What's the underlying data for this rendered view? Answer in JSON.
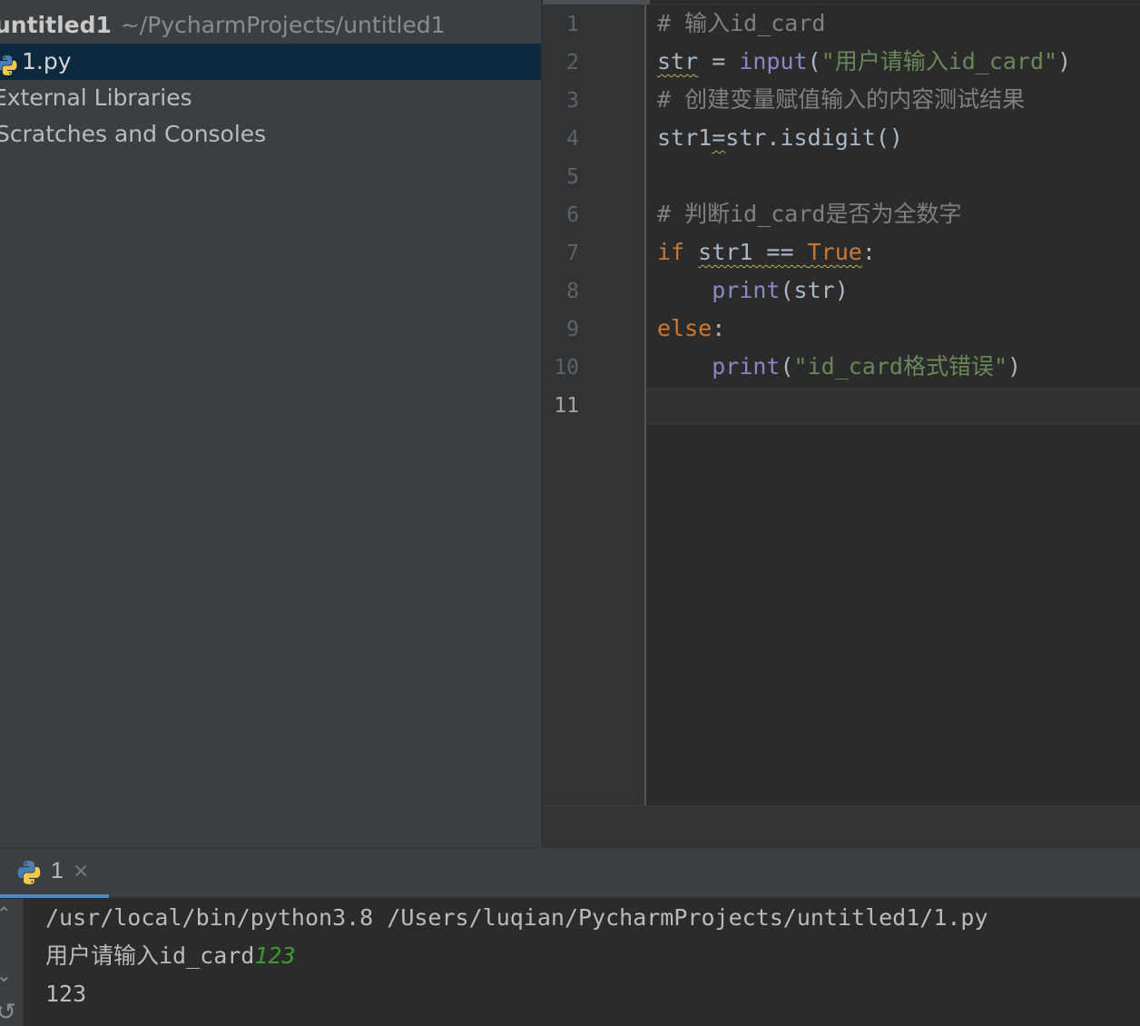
{
  "project_tree": {
    "root_name": "untitled1",
    "root_path": "~/PycharmProjects/untitled1",
    "file_name": "1.py",
    "external_libraries": "External Libraries",
    "scratches": "Scratches and Consoles"
  },
  "editor": {
    "line_numbers": [
      "1",
      "2",
      "3",
      "4",
      "5",
      "6",
      "7",
      "8",
      "9",
      "10",
      "11"
    ],
    "current_line": "11",
    "lines": [
      [
        {
          "t": "# 输入id_card",
          "k": "comment"
        }
      ],
      [
        {
          "t": "str",
          "k": "plain",
          "wavy": true
        },
        {
          "t": " = ",
          "k": "plain"
        },
        {
          "t": "input",
          "k": "builtin"
        },
        {
          "t": "(",
          "k": "plain"
        },
        {
          "t": "\"用户请输入id_card\"",
          "k": "string"
        },
        {
          "t": ")",
          "k": "plain"
        }
      ],
      [
        {
          "t": "# 创建变量赋值输入的内容测试结果",
          "k": "comment"
        }
      ],
      [
        {
          "t": "str1",
          "k": "plain"
        },
        {
          "t": "=",
          "k": "plain",
          "wavy": true
        },
        {
          "t": "str.isdigit()",
          "k": "plain"
        }
      ],
      [],
      [
        {
          "t": "# 判断id_card是否为全数字",
          "k": "comment"
        }
      ],
      [
        {
          "t": "if",
          "k": "keyword"
        },
        {
          "t": " ",
          "k": "plain"
        },
        {
          "t": "str1 == True",
          "k": "mixed-true",
          "wavy": true
        },
        {
          "t": ":",
          "k": "plain"
        }
      ],
      [
        {
          "t": "    ",
          "k": "plain"
        },
        {
          "t": "print",
          "k": "builtin"
        },
        {
          "t": "(str)",
          "k": "plain"
        }
      ],
      [
        {
          "t": "else",
          "k": "keyword"
        },
        {
          "t": ":",
          "k": "plain"
        }
      ],
      [
        {
          "t": "    ",
          "k": "plain"
        },
        {
          "t": "print",
          "k": "builtin"
        },
        {
          "t": "(",
          "k": "plain"
        },
        {
          "t": "\"id_card格式错误\"",
          "k": "string"
        },
        {
          "t": ")",
          "k": "plain"
        }
      ],
      []
    ]
  },
  "run": {
    "tab_label": "1",
    "close_glyph": "×",
    "command": "/usr/local/bin/python3.8 /Users/luqian/PycharmProjects/untitled1/1.py",
    "prompt_text": "用户请输入id_card",
    "user_input": "123",
    "output": "123"
  },
  "colors": {
    "comment": "#808080",
    "builtin": "#8888c6",
    "string": "#6a8759",
    "keyword": "#cc7832",
    "user_input": "#3d9a31",
    "selection": "#0d293e"
  }
}
